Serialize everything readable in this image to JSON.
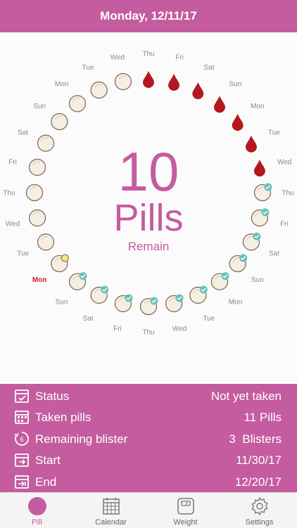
{
  "header": {
    "date": "Monday, 12/11/17"
  },
  "center": {
    "count": "10",
    "unit": "Pills",
    "sub": "Remain"
  },
  "dial": {
    "days": [
      {
        "label": "Thu",
        "state": "bleed"
      },
      {
        "label": "Fri",
        "state": "bleed"
      },
      {
        "label": "Sat",
        "state": "bleed"
      },
      {
        "label": "Sun",
        "state": "bleed"
      },
      {
        "label": "Mon",
        "state": "bleed"
      },
      {
        "label": "Tue",
        "state": "bleed"
      },
      {
        "label": "Wed",
        "state": "bleed"
      },
      {
        "label": "Thu",
        "state": "taken"
      },
      {
        "label": "Fri",
        "state": "taken"
      },
      {
        "label": "Sat",
        "state": "taken"
      },
      {
        "label": "Sun",
        "state": "taken"
      },
      {
        "label": "Mon",
        "state": "taken"
      },
      {
        "label": "Tue",
        "state": "taken"
      },
      {
        "label": "Wed",
        "state": "taken"
      },
      {
        "label": "Thu",
        "state": "taken"
      },
      {
        "label": "Fri",
        "state": "taken"
      },
      {
        "label": "Sat",
        "state": "taken"
      },
      {
        "label": "Sun",
        "state": "taken"
      },
      {
        "label": "Mon",
        "state": "today"
      },
      {
        "label": "Tue",
        "state": "pending"
      },
      {
        "label": "Wed",
        "state": "pending"
      },
      {
        "label": "Thu",
        "state": "pending"
      },
      {
        "label": "Fri",
        "state": "pending"
      },
      {
        "label": "Sat",
        "state": "pending"
      },
      {
        "label": "Sun",
        "state": "pending"
      },
      {
        "label": "Mon",
        "state": "pending"
      },
      {
        "label": "Tue",
        "state": "pending"
      },
      {
        "label": "Wed",
        "state": "pending"
      }
    ]
  },
  "info": {
    "rows": [
      {
        "icon": "status-icon",
        "label": "Status",
        "value": "Not yet taken"
      },
      {
        "icon": "taken-pills-icon",
        "label": "Taken pills",
        "value": "11 Pills"
      },
      {
        "icon": "remaining-blister-icon",
        "label": "Remaining blister",
        "value": "3  Blisters",
        "badge": "6"
      },
      {
        "icon": "start-calendar-icon",
        "label": "Start",
        "value": "11/30/17"
      },
      {
        "icon": "end-calendar-icon",
        "label": "End",
        "value": "12/20/17"
      }
    ]
  },
  "tabs": [
    {
      "name": "Pill",
      "icon": "pill-icon"
    },
    {
      "name": "Calendar",
      "icon": "calendar-icon"
    },
    {
      "name": "Weight",
      "icon": "scale-icon"
    },
    {
      "name": "Settings",
      "icon": "gear-icon"
    }
  ],
  "colors": {
    "accent": "#c45c9f",
    "blood": "#b3181f",
    "pill": "#f7eee2",
    "check": "#69c2b4",
    "today_dot": "#f3e57a",
    "today_label": "#c81e1e"
  }
}
